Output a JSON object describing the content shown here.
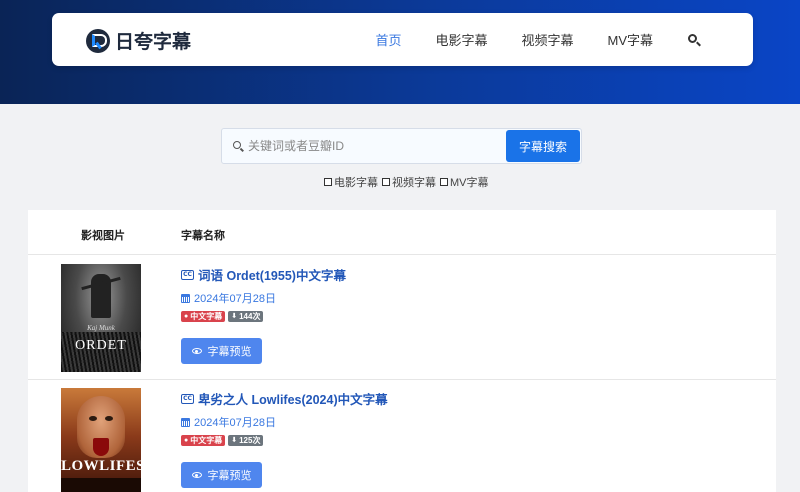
{
  "brand": {
    "name": "日夸字幕"
  },
  "nav": {
    "items": [
      {
        "label": "首页",
        "active": true
      },
      {
        "label": "电影字幕"
      },
      {
        "label": "视频字幕"
      },
      {
        "label": "MV字幕"
      }
    ],
    "search_icon": "search-icon"
  },
  "search": {
    "placeholder": "关键词或者豆瓣ID",
    "value": "",
    "button_label": "字幕搜索",
    "filters": [
      {
        "label": "电影字幕",
        "checked": false
      },
      {
        "label": "视频字幕",
        "checked": false
      },
      {
        "label": "MV字幕",
        "checked": false
      }
    ]
  },
  "table": {
    "headers": {
      "image": "影视图片",
      "name": "字幕名称"
    },
    "rows": [
      {
        "title": "词语 Ordet(1955)中文字幕",
        "date": "2024年07月28日",
        "lang_badge": "中文字幕",
        "downloads": "144次",
        "preview_label": "字幕预览",
        "poster": {
          "title": "ORDET",
          "subtitle": "Kaj Munk"
        }
      },
      {
        "title": "卑劣之人 Lowlifes(2024)中文字幕",
        "date": "2024年07月28日",
        "lang_badge": "中文字幕",
        "downloads": "125次",
        "preview_label": "字幕预览",
        "poster": {
          "title": "LOWLIFES"
        }
      }
    ]
  },
  "colors": {
    "accent": "#3a78e0",
    "title": "#2257b8",
    "search_button": "#1a73e8",
    "badge_lang": "#d9434c",
    "badge_dl": "#6c757d",
    "preview_button": "#4f86ee"
  }
}
